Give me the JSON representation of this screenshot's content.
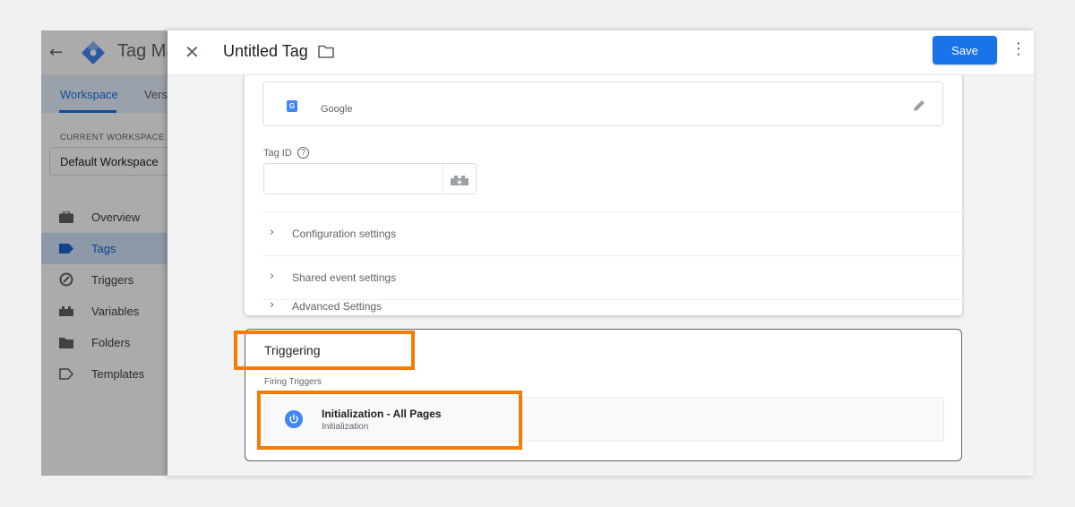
{
  "gtm": {
    "app_title": "Tag Ma",
    "tabs": [
      {
        "label": "Workspace",
        "active": true
      },
      {
        "label": "Vers",
        "active": false
      }
    ],
    "workspace_label": "CURRENT WORKSPACE",
    "workspace_name": "Default Workspace",
    "nav": [
      {
        "label": "Overview",
        "icon": "briefcase-icon"
      },
      {
        "label": "Tags",
        "icon": "tag-icon",
        "active": true
      },
      {
        "label": "Triggers",
        "icon": "trigger-icon"
      },
      {
        "label": "Variables",
        "icon": "variable-icon"
      },
      {
        "label": "Folders",
        "icon": "folder-icon"
      },
      {
        "label": "Templates",
        "icon": "template-icon"
      }
    ]
  },
  "editor": {
    "title": "Untitled Tag",
    "save_label": "Save",
    "tag_type": {
      "subtitle": "Google",
      "icon_letter": "G"
    },
    "tag_id_label": "Tag ID",
    "tag_id_value": "",
    "sections": [
      "Configuration settings",
      "Shared event settings",
      "Advanced Settings"
    ]
  },
  "triggering": {
    "title": "Triggering",
    "firing_label": "Firing Triggers",
    "trigger": {
      "name": "Initialization - All Pages",
      "type": "Initialization"
    }
  },
  "colors": {
    "accent": "#1a73e8",
    "highlight": "#f57c00"
  }
}
